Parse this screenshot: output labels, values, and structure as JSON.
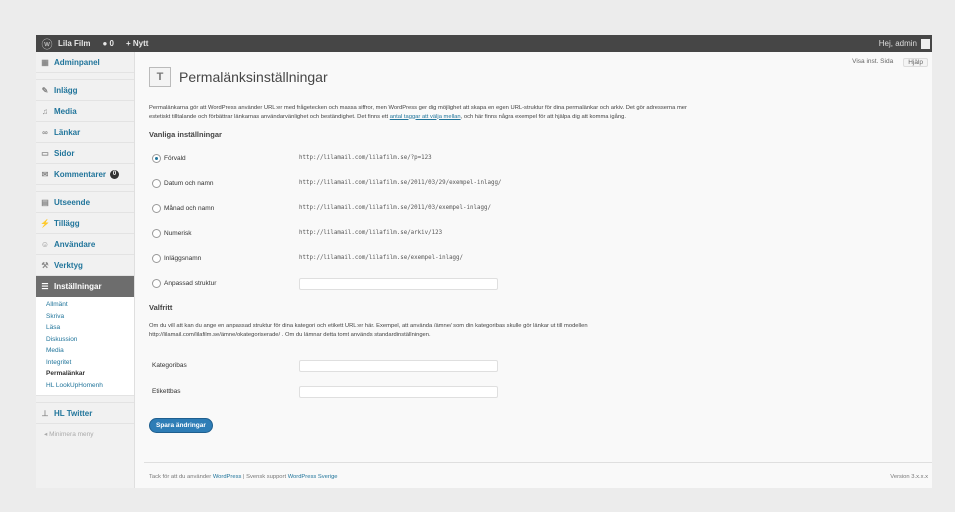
{
  "adminbar": {
    "site_name": "Lila Film",
    "comments_count": "0",
    "new_label": "+ Nytt",
    "greeting": "Hej, admin"
  },
  "sidebar": {
    "items": [
      {
        "label": "Adminpanel",
        "icon": "dashboard-icon"
      },
      {
        "label": "Inlägg",
        "icon": "pin-icon"
      },
      {
        "label": "Media",
        "icon": "media-icon"
      },
      {
        "label": "Länkar",
        "icon": "link-icon"
      },
      {
        "label": "Sidor",
        "icon": "page-icon"
      },
      {
        "label": "Kommentarer",
        "icon": "comment-icon",
        "badge": "0"
      },
      {
        "label": "Utseende",
        "icon": "appearance-icon"
      },
      {
        "label": "Tillägg",
        "icon": "plugin-icon"
      },
      {
        "label": "Användare",
        "icon": "users-icon"
      },
      {
        "label": "Verktyg",
        "icon": "tools-icon"
      },
      {
        "label": "Inställningar",
        "icon": "settings-icon"
      }
    ],
    "submenu": [
      "Allmänt",
      "Skriva",
      "Läsa",
      "Diskussion",
      "Media",
      "Integritet",
      "Permalänkar",
      "HL LookUpHomenh"
    ],
    "current_submenu": "Permalänkar",
    "extra_item": {
      "label": "HL Twitter",
      "icon": "twitter-icon"
    },
    "collapse_label": "Minimera meny"
  },
  "screen_meta": {
    "screen_options": "Visa inst. Sida",
    "help": "Hjälp"
  },
  "page": {
    "title": "Permalänksinställningar",
    "intro_1": "Permalänkarna gör att WordPress använder URL:er med frågetecken och massa siffror, men WordPress ger dig möjlighet att skapa en egen URL-struktur för dina permalänkar och arkiv. Det gör adresserna mer",
    "intro_2a": "estetiskt tilltalande och förbättrar länkarnas användarvänlighet och beständighet. Det finns ett ",
    "intro_link": "antal taggar att välja mellan",
    "intro_2b": ", och här finns några exempel för att hjälpa dig att komma igång.",
    "common_heading": "Vanliga inställningar",
    "options": [
      {
        "label": "Förvald",
        "example": "http://lilamail.com/lilafilm.se/?p=123",
        "checked": true
      },
      {
        "label": "Datum och namn",
        "example": "http://lilamail.com/lilafilm.se/2011/03/29/exempel-inlagg/",
        "checked": false
      },
      {
        "label": "Månad och namn",
        "example": "http://lilamail.com/lilafilm.se/2011/03/exempel-inlagg/",
        "checked": false
      },
      {
        "label": "Numerisk",
        "example": "http://lilamail.com/lilafilm.se/arkiv/123",
        "checked": false
      },
      {
        "label": "Inläggsnamn",
        "example": "http://lilamail.com/lilafilm.se/exempel-inlagg/",
        "checked": false
      },
      {
        "label": "Anpassad struktur",
        "example": "",
        "checked": false
      }
    ],
    "optional_heading": "Valfritt",
    "optional_desc_1": "Om du vill att kan du ange en anpassad struktur för dina kategori och etikett URL:er här. Exempel, att använda  /ämne/  som din kategoribas skulle gör länkar ut till modellen",
    "optional_desc_2": "http://lilamail.com/lilafilm.se/ämne/okategoriserade/ . Om du lämnar detta tomt används standardinställningen.",
    "category_label": "Kategoribas",
    "tag_label": "Etikettbas",
    "save_button": "Spara ändringar"
  },
  "footer": {
    "text_before": "Tack för att du använder ",
    "link1": "WordPress",
    "text_mid": " | Svensk support ",
    "link2": "WordPress Sverige",
    "version": "Version 3.x.x.x"
  }
}
